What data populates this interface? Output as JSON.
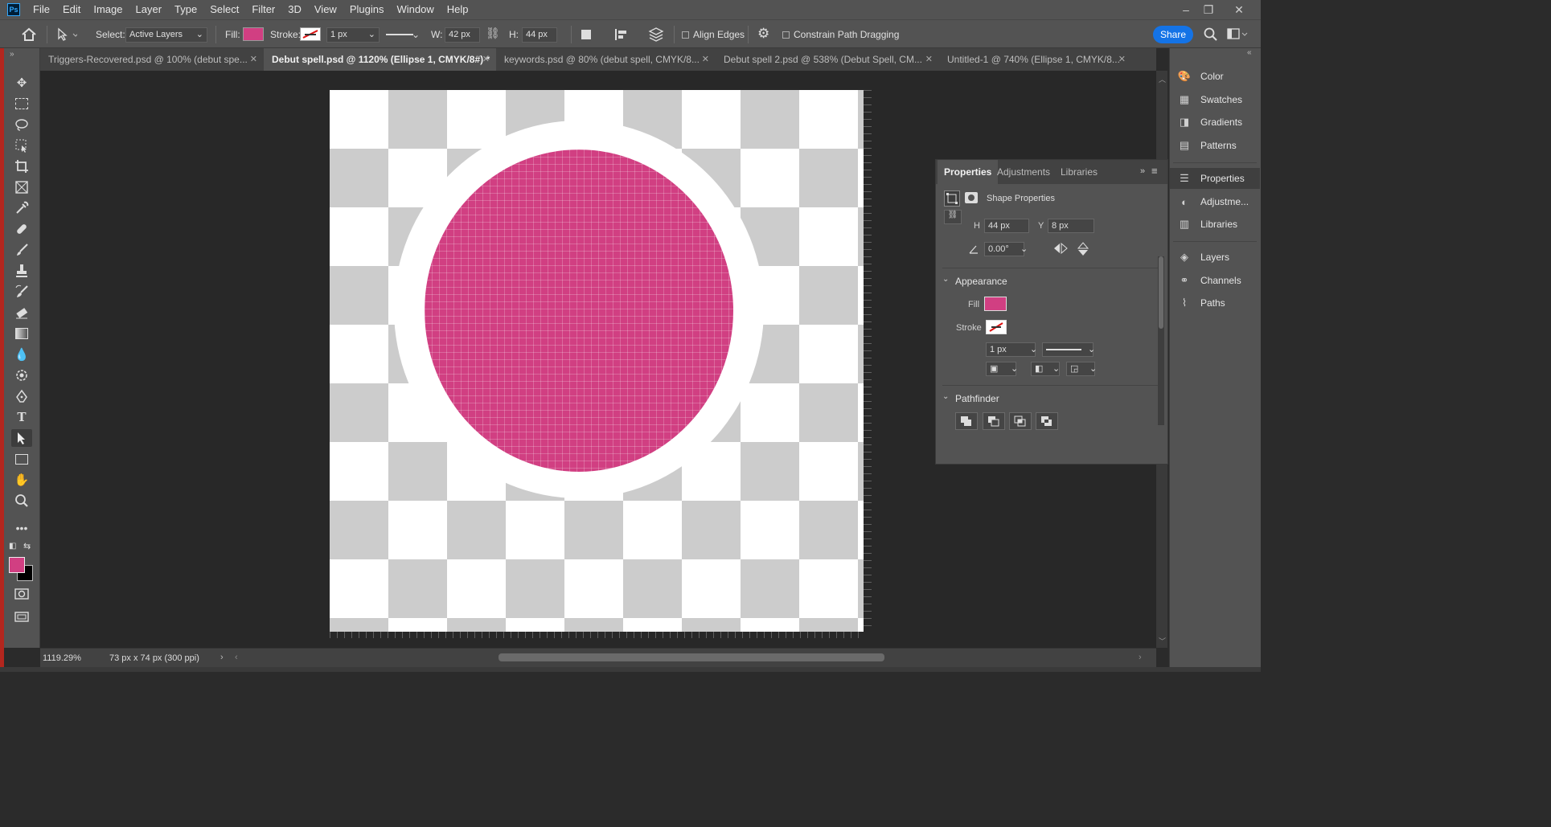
{
  "app": {
    "logo": "Ps"
  },
  "menu": [
    "File",
    "Edit",
    "Image",
    "Layer",
    "Type",
    "Select",
    "Filter",
    "3D",
    "View",
    "Plugins",
    "Window",
    "Help"
  ],
  "window_controls": {
    "minimize": "–",
    "restore": "❐",
    "close": "✕"
  },
  "options": {
    "select_label": "Select:",
    "select_value": "Active Layers",
    "fill_label": "Fill:",
    "stroke_label": "Stroke:",
    "stroke_width": "1 px",
    "w_label": "W:",
    "w_value": "42 px",
    "h_label": "H:",
    "h_value": "44 px",
    "align_edges": "Align Edges",
    "constrain": "Constrain Path Dragging",
    "share": "Share",
    "fill_color": "#d13f82"
  },
  "tabs": [
    {
      "label": "Triggers-Recovered.psd @ 100% (debut spe...",
      "active": false
    },
    {
      "label": "Debut spell.psd @ 1120% (Ellipse 1, CMYK/8#) *",
      "active": true
    },
    {
      "label": "keywords.psd @ 80% (debut spell, CMYK/8...",
      "active": false
    },
    {
      "label": "Debut spell 2.psd @ 538% (Debut Spell, CM...",
      "active": false
    },
    {
      "label": "Untitled-1 @ 740% (Ellipse 1, CMYK/8...",
      "active": false
    }
  ],
  "status": {
    "zoom": "1119.29%",
    "doc_info": "73 px x 74 px (300 ppi)"
  },
  "properties": {
    "tabs": [
      "Properties",
      "Adjustments",
      "Libraries"
    ],
    "title": "Shape Properties",
    "h_label": "H",
    "h_value": "44 px",
    "y_label": "Y",
    "y_value": "8 px",
    "angle": "0.00°",
    "appearance": "Appearance",
    "fill_label": "Fill",
    "stroke_label": "Stroke",
    "stroke_width": "1 px",
    "pathfinder": "Pathfinder"
  },
  "dock": {
    "group1": [
      "Color",
      "Swatches",
      "Gradients",
      "Patterns"
    ],
    "group2": [
      "Properties",
      "Adjustme...",
      "Libraries"
    ],
    "group3": [
      "Layers",
      "Channels",
      "Paths"
    ]
  },
  "colors": {
    "foreground": "#d13f82",
    "background": "#000000",
    "accent": "#1473e6"
  }
}
